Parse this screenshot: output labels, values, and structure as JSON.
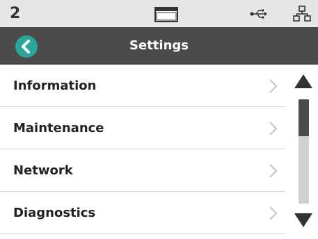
{
  "status_bar": {
    "station_number": "2",
    "icons": [
      "display-icon",
      "usb-icon",
      "network-icon"
    ]
  },
  "header": {
    "back_icon": "chevron-left-icon",
    "title": "Settings"
  },
  "menu": {
    "items": [
      {
        "label": "Information",
        "icon": "chevron-right-icon"
      },
      {
        "label": "Maintenance",
        "icon": "chevron-right-icon"
      },
      {
        "label": "Network",
        "icon": "chevron-right-icon"
      },
      {
        "label": "Diagnostics",
        "icon": "chevron-right-icon"
      }
    ]
  },
  "scrollbar": {
    "up_icon": "triangle-up-icon",
    "down_icon": "triangle-down-icon",
    "position_fraction": 0.0,
    "visible_fraction": 0.35
  },
  "colors": {
    "status_bar_bg": "#e6e6e6",
    "title_bar_bg": "#4b4b4b",
    "accent": "#2aa69a",
    "scroll_track": "#d0d0d0",
    "scroll_thumb": "#4b4b4b"
  }
}
